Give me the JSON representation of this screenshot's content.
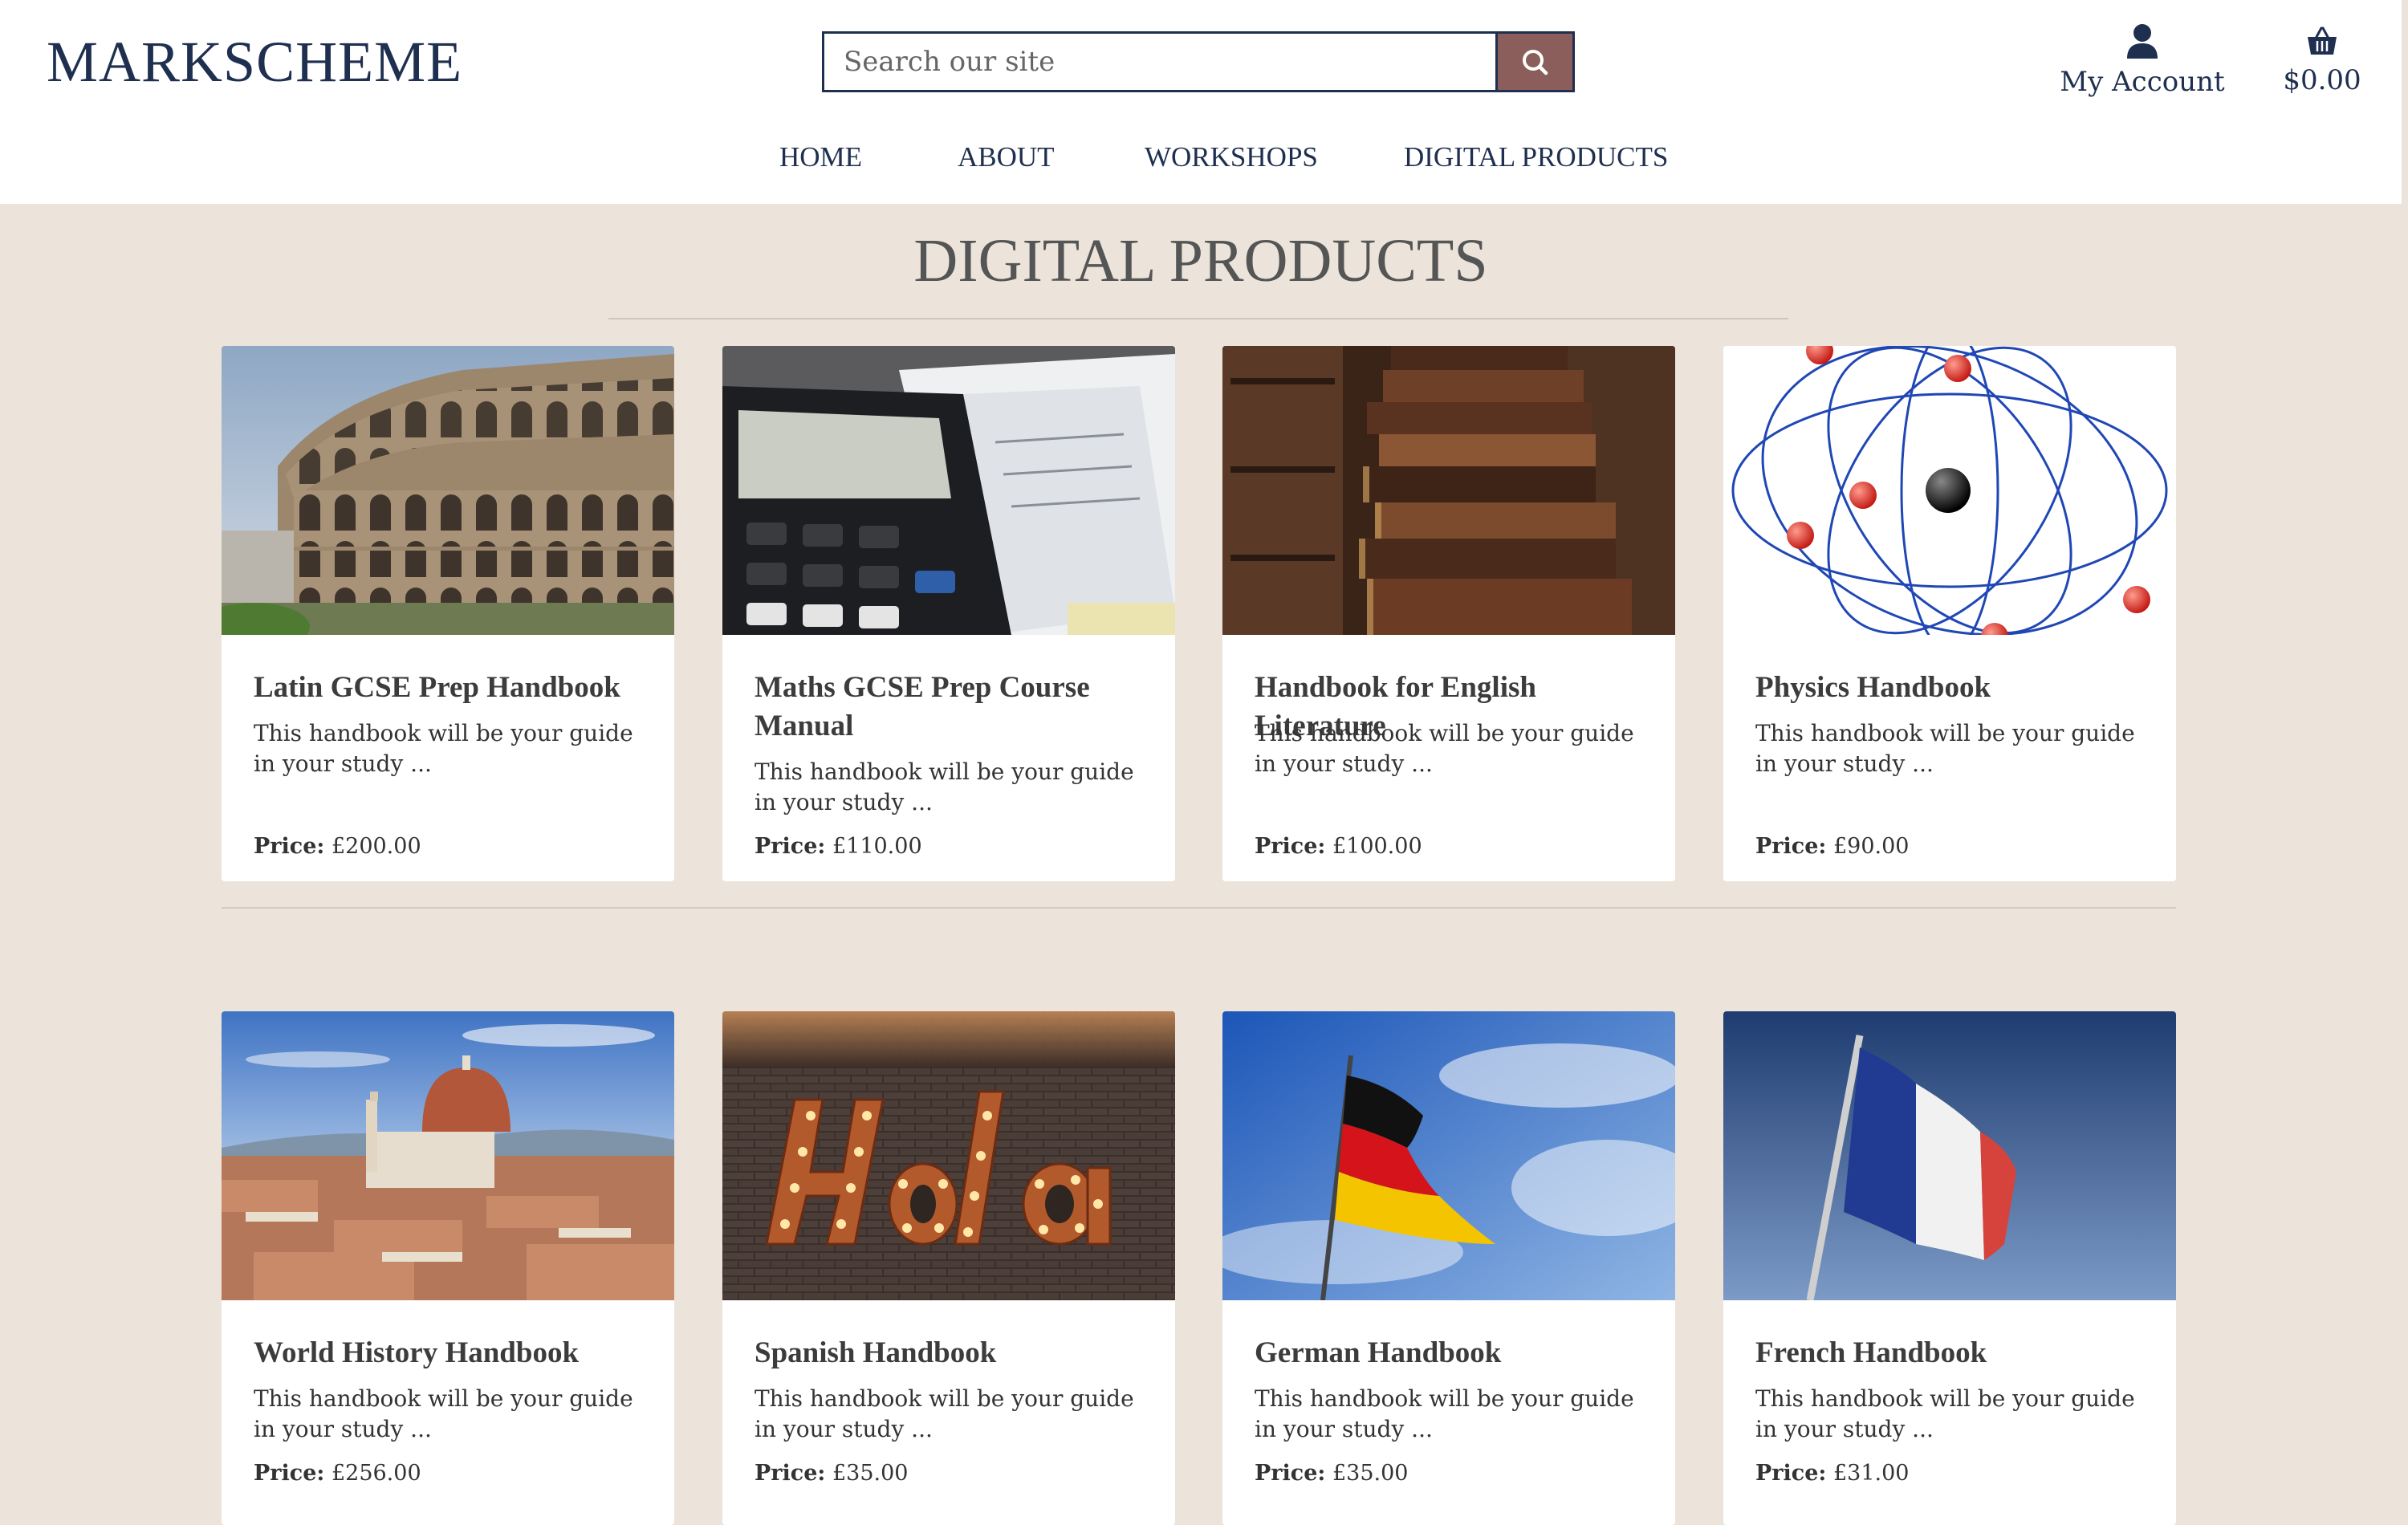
{
  "header": {
    "logo": "MARKSCHEME",
    "search_placeholder": "Search our site",
    "account_label": "My Account",
    "cart_total": "$0.00",
    "icons": {
      "search": "search-icon",
      "account": "user-icon",
      "cart": "basket-icon"
    },
    "search_button_color": "#8b5e5b"
  },
  "nav": [
    "HOME",
    "ABOUT",
    "WORKSHOPS",
    "DIGITAL PRODUCTS"
  ],
  "page": {
    "title": "DIGITAL PRODUCTS",
    "background": "#ece4da"
  },
  "price_label": "Price:",
  "products": [
    {
      "name": "Latin GCSE Prep Handbook",
      "desc": "This handbook will be your guide in your study ...",
      "price": "£200.00",
      "image": "colosseum"
    },
    {
      "name": "Maths GCSE Prep Course Manual",
      "desc": "This handbook will be your guide in your study ...",
      "price": "£110.00",
      "image": "calculator"
    },
    {
      "name": "Handbook for English Literature",
      "desc": "This handbook will be your guide in your study ...",
      "price": "£100.00",
      "image": "old books"
    },
    {
      "name": "Physics Handbook",
      "desc": "This handbook will be your guide in your study ...",
      "price": "£90.00",
      "image": "atom"
    },
    {
      "name": "World History Handbook",
      "desc": "This handbook will be your guide in your study ...",
      "price": "£256.00",
      "image": "florence"
    },
    {
      "name": "Spanish Handbook",
      "desc": "This handbook will be your guide in your study ...",
      "price": "£35.00",
      "image": "hola sign"
    },
    {
      "name": "German Handbook",
      "desc": "This handbook will be your guide in your study ...",
      "price": "£35.00",
      "image": "german flag"
    },
    {
      "name": "French Handbook",
      "desc": "This handbook will be your guide in your study ...",
      "price": "£31.00",
      "image": "french flag"
    }
  ]
}
